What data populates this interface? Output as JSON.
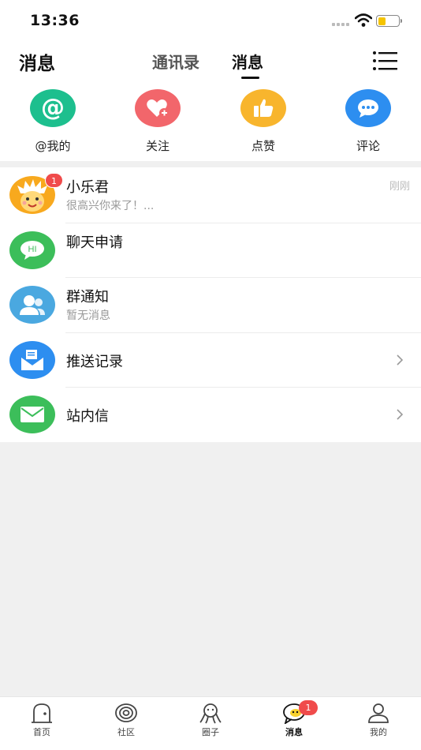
{
  "status_bar": {
    "time": "13:36"
  },
  "header": {
    "title": "消息",
    "tabs": [
      {
        "label": "通讯录",
        "active": false
      },
      {
        "label": "消息",
        "active": true
      }
    ]
  },
  "quick_actions": [
    {
      "label": "@我的",
      "icon": "at-icon",
      "color": "#1dbf8e"
    },
    {
      "label": "关注",
      "icon": "heart-plus-icon",
      "color": "#f2666b"
    },
    {
      "label": "点赞",
      "icon": "thumbs-up-icon",
      "color": "#f8b52d"
    },
    {
      "label": "评论",
      "icon": "comment-icon",
      "color": "#2d8ef0"
    }
  ],
  "messages": [
    {
      "title": "小乐君",
      "subtitle": "很高兴你来了！...",
      "time": "刚刚",
      "badge": "1",
      "icon": "mascot-avatar"
    },
    {
      "title": "聊天申请",
      "icon": "chat-hi-icon",
      "color": "#3cbe5a"
    },
    {
      "title": "群通知",
      "subtitle": "暂无消息",
      "icon": "group-icon",
      "color": "#4aa8e0"
    },
    {
      "title": "推送记录",
      "icon": "push-mail-icon",
      "color": "#2d8ef0"
    },
    {
      "title": "站内信",
      "icon": "envelope-icon",
      "color": "#3cbe5a"
    }
  ],
  "bottom_nav": [
    {
      "label": "首页",
      "icon": "home-icon"
    },
    {
      "label": "社区",
      "icon": "community-icon"
    },
    {
      "label": "圈子",
      "icon": "circle-icon"
    },
    {
      "label": "消息",
      "icon": "message-icon",
      "active": true,
      "badge": "1"
    },
    {
      "label": "我的",
      "icon": "profile-icon"
    }
  ]
}
